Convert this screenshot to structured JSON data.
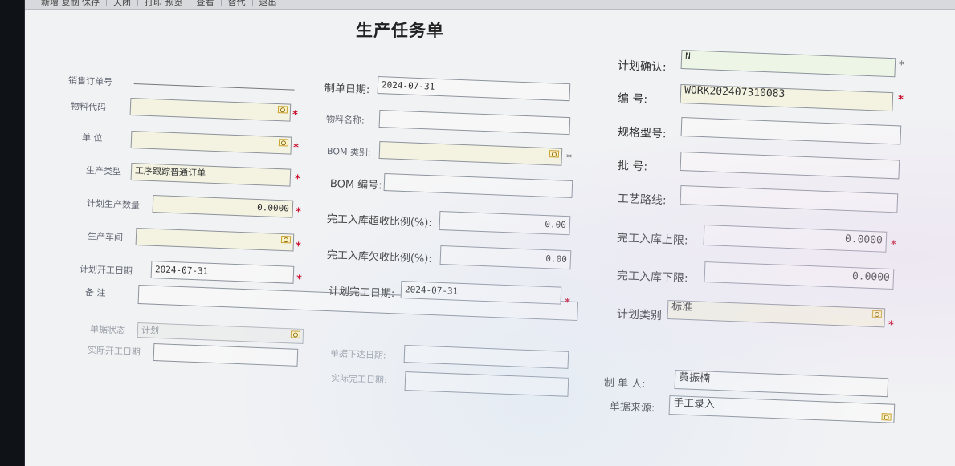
{
  "toolbar": {
    "items": [
      "新增 复制 保存",
      "关闭",
      "打印 预览",
      "查看",
      "替代",
      "退出"
    ]
  },
  "form": {
    "title": "生产任务单",
    "required_mark": "*",
    "col1": {
      "sales_order_no": {
        "label": "销售订单号",
        "value": ""
      },
      "material_code": {
        "label": "物料代码",
        "value": ""
      },
      "unit": {
        "label": "单    位",
        "value": ""
      },
      "production_type": {
        "label": "生产类型",
        "value": "工序跟踪普通订单"
      },
      "planned_qty": {
        "label": "计划生产数量",
        "value": "0.0000"
      },
      "workshop": {
        "label": "生产车间",
        "value": ""
      },
      "planned_start": {
        "label": "计划开工日期",
        "value": "2024-07-31"
      },
      "remarks": {
        "label": "备    注",
        "value": ""
      },
      "doc_status": {
        "label": "单据状态",
        "value": "计划"
      },
      "actual_start": {
        "label": "实际开工日期",
        "value": ""
      }
    },
    "col2": {
      "created_date": {
        "label": "制单日期:",
        "value": "2024-07-31"
      },
      "material_name": {
        "label": "物料名称:",
        "value": ""
      },
      "bom_category": {
        "label": "BOM 类别:",
        "value": ""
      },
      "bom_no": {
        "label": "BOM 编号:",
        "value": ""
      },
      "over_receipt": {
        "label": "完工入库超收比例(%):",
        "value": "0.00"
      },
      "under_receipt": {
        "label": "完工入库欠收比例(%):",
        "value": "0.00"
      },
      "planned_finish": {
        "label": "计划完工日期:",
        "value": "2024-07-31"
      },
      "issue_date": {
        "label": "单据下达日期:",
        "value": ""
      },
      "actual_finish": {
        "label": "实际完工日期:",
        "value": ""
      }
    },
    "col3": {
      "plan_confirm": {
        "label": "计划确认:",
        "value": "N"
      },
      "number": {
        "label": "编    号:",
        "value": "WORK202407310083"
      },
      "spec_model": {
        "label": "规格型号:",
        "value": ""
      },
      "batch_no": {
        "label": "批    号:",
        "value": ""
      },
      "routing": {
        "label": "工艺路线:",
        "value": ""
      },
      "receipt_upper": {
        "label": "完工入库上限:",
        "value": "0.0000"
      },
      "receipt_lower": {
        "label": "完工入库下限:",
        "value": "0.0000"
      },
      "plan_category": {
        "label": "计划类别",
        "value": "标准"
      },
      "creator": {
        "label": "制 单 人:",
        "value": "黄振楠"
      },
      "doc_source": {
        "label": "单据来源:",
        "value": "手工录入"
      }
    }
  }
}
